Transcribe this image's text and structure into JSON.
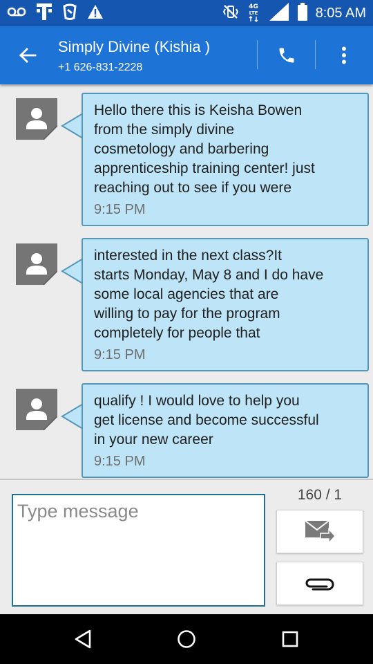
{
  "status_bar": {
    "time": "8:05 AM",
    "network_label": "4G LTE",
    "icons": [
      "voicemail-icon",
      "tmobile-logo-icon",
      "app-notification-icon",
      "warning-icon",
      "vibrate-icon",
      "network-4g-lte-icon",
      "signal-icon",
      "battery-icon"
    ]
  },
  "header": {
    "contact_name": "Simply Divine (Kishia )",
    "phone_number": "+1 626-831-2228",
    "color": "#1e73d7",
    "status_color": "#1557b0"
  },
  "messages": [
    {
      "text": "Hello there this is Keisha Bowen\nfrom the simply divine\ncosmetology and barbering\napprenticeship training center! just\nreaching out to see if you were",
      "time": "9:15 PM"
    },
    {
      "text": "interested in the next class?It\nstarts Monday, May 8 and I do have\nsome local agencies that are\nwilling to pay for the program\ncompletely for people that",
      "time": "9:15 PM"
    },
    {
      "text": "qualify ! I would love to help you\nget license and become successful\nin your new career",
      "time": "9:15 PM"
    }
  ],
  "bubble_colors": {
    "fill": "#bde4f7",
    "border": "#5597b8"
  },
  "compose": {
    "placeholder": "Type message",
    "value": "",
    "counter": "160 / 1",
    "send_icon": "send-mail-icon",
    "attach_icon": "paperclip-icon"
  },
  "nav": {
    "icons": [
      "back-triangle-icon",
      "home-circle-icon",
      "recents-square-icon"
    ]
  }
}
